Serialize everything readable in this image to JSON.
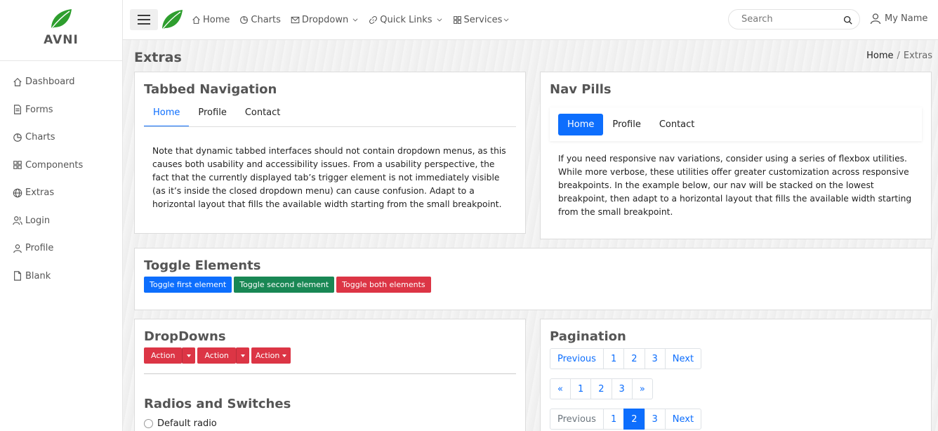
{
  "brand": {
    "name": "AVNI",
    "accent": "#2e9e2e"
  },
  "sidebar": {
    "items": [
      {
        "label": "Dashboard",
        "icon": "home-icon"
      },
      {
        "label": "Forms",
        "icon": "file-icon"
      },
      {
        "label": "Charts",
        "icon": "pie-chart-icon"
      },
      {
        "label": "Components",
        "icon": "grid-icon"
      },
      {
        "label": "Extras",
        "icon": "globe-icon"
      },
      {
        "label": "Login",
        "icon": "users-icon"
      },
      {
        "label": "Profile",
        "icon": "user-icon"
      },
      {
        "label": "Blank",
        "icon": "file-icon"
      }
    ]
  },
  "topbar": {
    "items": [
      {
        "label": "Home",
        "icon": "home-icon"
      },
      {
        "label": "Charts",
        "icon": "pie-chart-icon"
      },
      {
        "label": "Dropdown",
        "icon": "mail-icon"
      },
      {
        "label": "Quick Links",
        "icon": "link-icon"
      },
      {
        "label": "Services",
        "icon": "grid-icon"
      }
    ],
    "search_placeholder": "Search",
    "user_name": "My Name"
  },
  "page": {
    "title": "Extras",
    "breadcrumb": {
      "home": "Home",
      "separator": "/",
      "current": "Extras"
    }
  },
  "tabbed": {
    "title": "Tabbed Navigation",
    "tabs": [
      "Home",
      "Profile",
      "Contact"
    ],
    "text": "Note that dynamic tabbed interfaces should not contain dropdown menus, as this causes both usability and accessibility issues. From a usability perspective, the fact that the currently displayed tab’s trigger element is not immediately visible (as it’s inside the closed dropdown menu) can cause confusion. Adapt to a horizontal layout that fills the available width starting from the small breakpoint."
  },
  "pills": {
    "title": "Nav Pills",
    "items": [
      "Home",
      "Profile",
      "Contact"
    ],
    "text": "If you need responsive nav variations, consider using a series of flexbox utilities. While more verbose, these utilities offer greater customization across responsive breakpoints. In the example below, our nav will be stacked on the lowest breakpoint, then adapt to a horizontal layout that fills the available width starting from the small breakpoint."
  },
  "toggle": {
    "title": "Toggle Elements",
    "buttons": [
      "Toggle first element",
      "Toggle second element",
      "Toggle both elements"
    ]
  },
  "dropdowns": {
    "title": "DropDowns",
    "buttons": [
      "Action",
      "Action",
      "Action"
    ]
  },
  "radios": {
    "title": "Radios and Switches",
    "default_radio": "Default radio"
  },
  "pagination": {
    "title": "Pagination",
    "row1": [
      "Previous",
      "1",
      "2",
      "3",
      "Next"
    ],
    "row2": [
      "«",
      "1",
      "2",
      "3",
      "»"
    ],
    "row3": [
      "Previous",
      "1",
      "2",
      "3",
      "Next"
    ]
  }
}
